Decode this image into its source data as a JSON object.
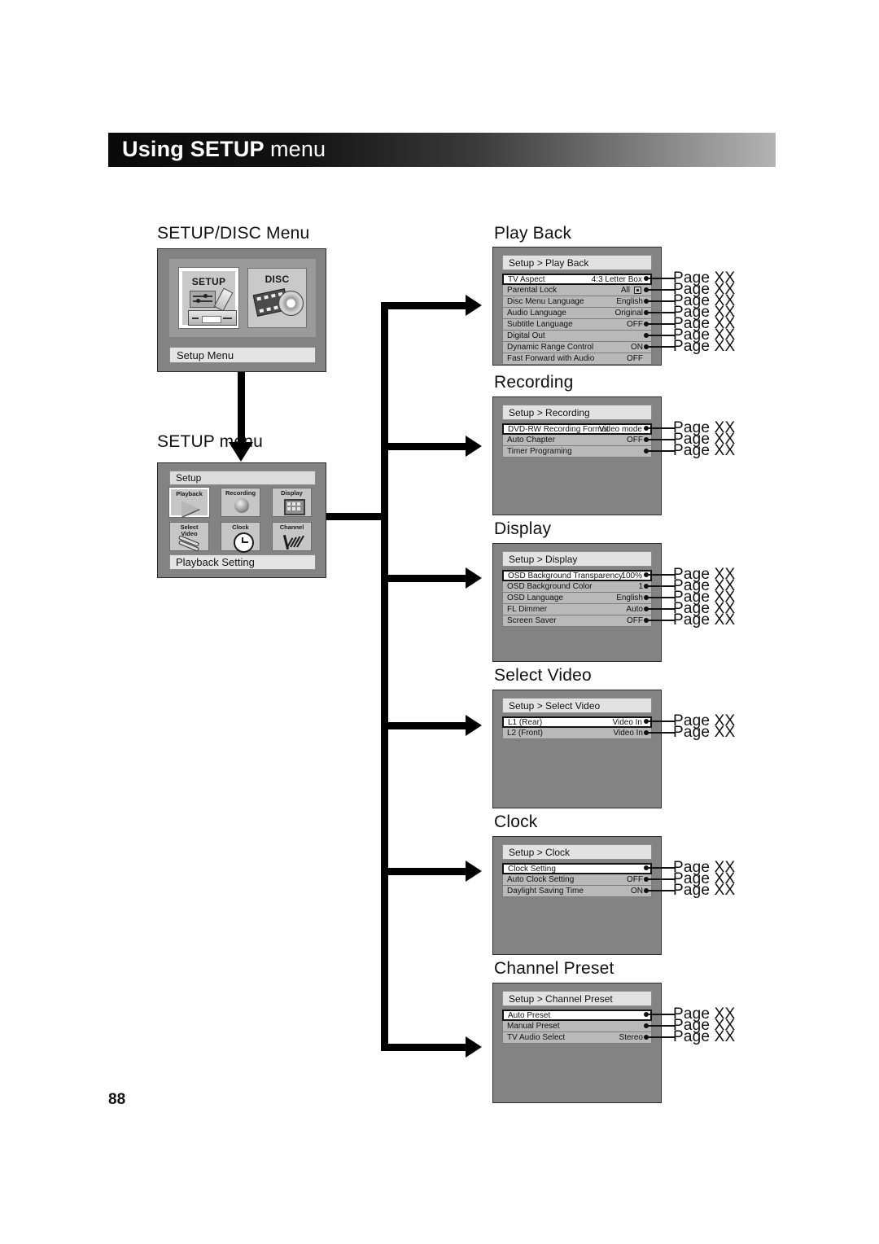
{
  "header": {
    "title_bold": "Using SETUP",
    "title_thin": "menu"
  },
  "page_number": "88",
  "captions": {
    "setup_disc_menu": "SETUP/DISC Menu",
    "setup_menu": "SETUP menu",
    "play_back": "Play Back",
    "recording": "Recording",
    "display": "Display",
    "select_video": "Select Video",
    "clock": "Clock",
    "channel_preset": "Channel Preset"
  },
  "page_ref_label": "Page XX",
  "setup_disc_screen": {
    "tiles": [
      {
        "label": "SETUP",
        "icon": "setup-device-icon",
        "selected": true
      },
      {
        "label": "DISC",
        "icon": "disc-film-icon",
        "selected": false
      }
    ],
    "status": "Setup Menu"
  },
  "setup_menu_screen": {
    "title": "Setup",
    "tiles": [
      {
        "label": "Playback",
        "icon": "play-triangle-icon",
        "selected": true
      },
      {
        "label": "Recording",
        "icon": "record-circle-icon",
        "selected": false
      },
      {
        "label": "Display",
        "icon": "display-panel-icon",
        "selected": false
      },
      {
        "label": "Select\nVideo",
        "label_line1": "Select",
        "label_line2": "Video",
        "icon": "av-cable-icon",
        "selected": false
      },
      {
        "label": "Clock",
        "icon": "clock-icon",
        "selected": false
      },
      {
        "label": "Channel",
        "icon": "antenna-icon",
        "selected": false
      }
    ],
    "status": "Playback Setting"
  },
  "osd_menus": [
    {
      "key": "play_back",
      "header": "Setup > Play Back",
      "rows": [
        {
          "label": "TV Aspect",
          "value": "4:3 Letter Box",
          "highlight": true,
          "page_ref": true
        },
        {
          "label": "Parental Lock",
          "value": "All",
          "lock_icon": true,
          "highlight": false,
          "page_ref": true
        },
        {
          "label": "Disc Menu Language",
          "value": "English",
          "highlight": false,
          "page_ref": true
        },
        {
          "label": "Audio Language",
          "value": "Original",
          "highlight": false,
          "page_ref": true
        },
        {
          "label": "Subtitle Language",
          "value": "OFF",
          "highlight": false,
          "page_ref": true
        },
        {
          "label": "Digital Out",
          "value": "",
          "highlight": false,
          "page_ref": true
        },
        {
          "label": "Dynamic Range Control",
          "value": "ON",
          "highlight": false,
          "page_ref": true
        },
        {
          "label": "Fast Forward with Audio",
          "value": "OFF",
          "highlight": false,
          "page_ref": false
        }
      ]
    },
    {
      "key": "recording",
      "header": "Setup > Recording",
      "rows": [
        {
          "label": "DVD-RW Recording Format",
          "value": "Video mode",
          "highlight": true,
          "page_ref": true
        },
        {
          "label": "Auto Chapter",
          "value": "OFF",
          "highlight": false,
          "page_ref": true
        },
        {
          "label": "Timer Programing",
          "value": "",
          "highlight": false,
          "page_ref": true
        }
      ]
    },
    {
      "key": "display",
      "header": "Setup > Display",
      "rows": [
        {
          "label": "OSD Background Transparency",
          "value": "100%",
          "highlight": true,
          "page_ref": true
        },
        {
          "label": "OSD Background Color",
          "value": "1",
          "highlight": false,
          "page_ref": true
        },
        {
          "label": "OSD Language",
          "value": "English",
          "highlight": false,
          "page_ref": true
        },
        {
          "label": "FL Dimmer",
          "value": "Auto",
          "highlight": false,
          "page_ref": true
        },
        {
          "label": "Screen Saver",
          "value": "OFF",
          "highlight": false,
          "page_ref": true
        }
      ]
    },
    {
      "key": "select_video",
      "header": "Setup > Select Video",
      "rows": [
        {
          "label": "L1 (Rear)",
          "value": "Video In",
          "highlight": true,
          "page_ref": true
        },
        {
          "label": "L2 (Front)",
          "value": "Video In",
          "highlight": false,
          "page_ref": true
        }
      ]
    },
    {
      "key": "clock",
      "header": "Setup > Clock",
      "rows": [
        {
          "label": "Clock Setting",
          "value": "",
          "highlight": true,
          "page_ref": true
        },
        {
          "label": "Auto Clock Setting",
          "value": "OFF",
          "highlight": false,
          "page_ref": true
        },
        {
          "label": "Daylight Saving Time",
          "value": "ON",
          "highlight": false,
          "page_ref": true
        }
      ]
    },
    {
      "key": "channel_preset",
      "header": "Setup > Channel Preset",
      "rows": [
        {
          "label": "Auto Preset",
          "value": "",
          "highlight": true,
          "page_ref": true
        },
        {
          "label": "Manual Preset",
          "value": "",
          "highlight": false,
          "page_ref": true
        },
        {
          "label": "TV Audio Select",
          "value": "Stereo",
          "highlight": false,
          "page_ref": true
        }
      ]
    }
  ],
  "colors": {
    "osd_background": "#838383",
    "osd_row": "#b9b9b9",
    "osd_header": "#e2e2e2",
    "highlight_row": "#ffffff",
    "connector": "#000000",
    "banner_dark": "#0a0a0a",
    "banner_light": "#b3b3b3"
  }
}
